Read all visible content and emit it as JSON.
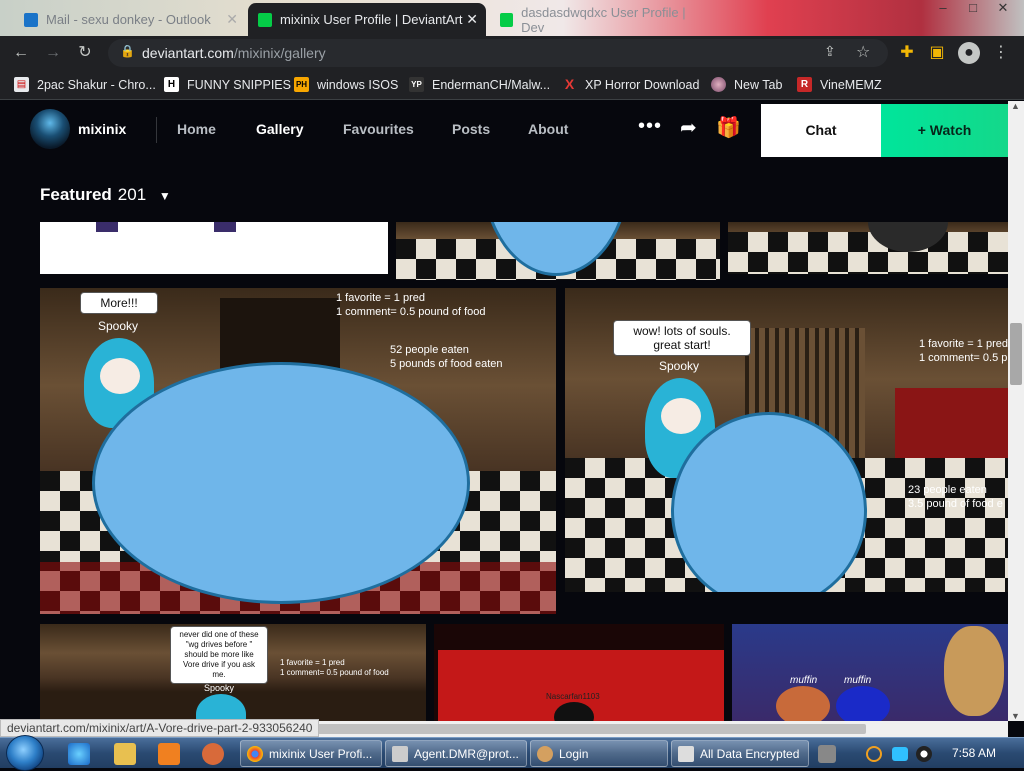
{
  "browser": {
    "tabs": [
      {
        "title": "Mail - sexu donkey - Outlook",
        "active": false
      },
      {
        "title": "mixinix User Profile | DeviantArt",
        "active": true
      },
      {
        "title": "dasdasdwqdxc User Profile | Dev",
        "active": false
      }
    ],
    "url_host": "deviantart.com",
    "url_path": "/mixinix/gallery",
    "bookmarks": [
      {
        "label": "2pac Shakur - Chro...",
        "icon": "document-icon"
      },
      {
        "label": "FUNNY SNIPPIES",
        "icon": "H"
      },
      {
        "label": "windows ISOS",
        "icon": "PH"
      },
      {
        "label": "EndermanCH/Malw...",
        "icon": "YP"
      },
      {
        "label": "XP Horror Download",
        "icon": "X"
      },
      {
        "label": "New Tab",
        "icon": "globe-icon"
      },
      {
        "label": "VineMEMZ",
        "icon": "R"
      }
    ]
  },
  "profile": {
    "username": "mixinix",
    "nav": [
      "Home",
      "Gallery",
      "Favourites",
      "Posts",
      "About"
    ],
    "active_nav": "Gallery",
    "chat_label": "Chat",
    "watch_label": "Watch",
    "watch_prefix": "+",
    "featured_label": "Featured",
    "featured_count": "201"
  },
  "tiles": {
    "tile_a": {
      "speech": "More!!!",
      "name": "Spooky",
      "caption1": "1 favorite = 1 pred",
      "caption2": "1 comment= 0.5 pound of food",
      "stat1": "52 people eaten",
      "stat2": "5 pounds of food eaten"
    },
    "tile_b": {
      "speech": "wow! lots of souls. great start!",
      "name": "Spooky",
      "caption1": "1 favorite = 1 pred",
      "caption2": "1 comment= 0.5 p",
      "stat1": "23 people eaten",
      "stat2": "3.5 pound of food e"
    },
    "tile_c": {
      "speech": "never did one of these \"wg drives before \" should be more like Vore drive if you ask me.",
      "name": "Spooky",
      "caption1": "1 favorite = 1 pred",
      "caption2": "1 comment= 0.5 pound of food"
    },
    "tile_d": {
      "label": "Nascarfan1103"
    },
    "tile_e": {
      "label1": "muffin",
      "label2": "muffin"
    }
  },
  "status_url": "deviantart.com/mixinix/art/A-Vore-drive-part-2-933056240",
  "taskbar": {
    "buttons": [
      {
        "label": "mixinix User Profi..."
      },
      {
        "label": "Agent.DMR@prot..."
      },
      {
        "label": "Login"
      },
      {
        "label": "All Data Encrypted"
      }
    ],
    "clock": "7:58 AM"
  },
  "colors": {
    "watch_green": "#00e59b",
    "bubble_blue": "#6fb6ea",
    "page_bg": "#06070d"
  }
}
